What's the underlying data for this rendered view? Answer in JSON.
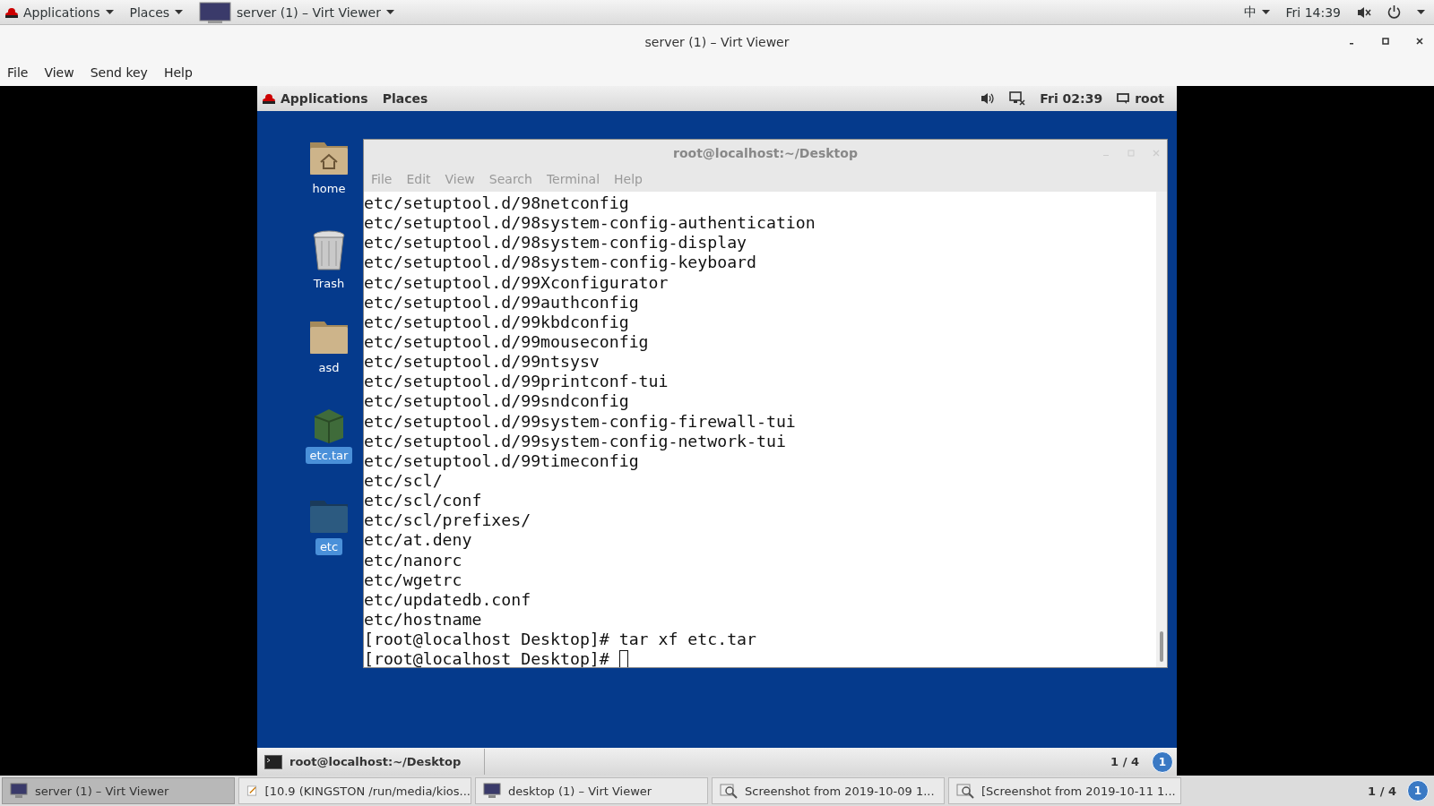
{
  "top_bar": {
    "applications": "Applications",
    "places": "Places",
    "active_app": "server (1) – Virt Viewer",
    "input_method": "中",
    "clock": "Fri 14:39"
  },
  "window": {
    "title": "server (1) – Virt Viewer"
  },
  "menu": [
    "File",
    "View",
    "Send key",
    "Help"
  ],
  "guest": {
    "top_bar": {
      "applications": "Applications",
      "places": "Places",
      "clock": "Fri 02:39",
      "user": "root"
    },
    "desktop_icons": [
      {
        "kind": "home",
        "label": "home",
        "selected": false
      },
      {
        "kind": "trash",
        "label": "Trash",
        "selected": false
      },
      {
        "kind": "folder",
        "label": "asd",
        "selected": false
      },
      {
        "kind": "archive",
        "label": "etc.tar",
        "selected": true
      },
      {
        "kind": "dark-folder",
        "label": "etc",
        "selected": true
      }
    ],
    "terminal": {
      "title": "root@localhost:~/Desktop",
      "menu": [
        "File",
        "Edit",
        "View",
        "Search",
        "Terminal",
        "Help"
      ],
      "lines": [
        "etc/setuptool.d/98netconfig",
        "etc/setuptool.d/98system-config-authentication",
        "etc/setuptool.d/98system-config-display",
        "etc/setuptool.d/98system-config-keyboard",
        "etc/setuptool.d/99Xconfigurator",
        "etc/setuptool.d/99authconfig",
        "etc/setuptool.d/99kbdconfig",
        "etc/setuptool.d/99mouseconfig",
        "etc/setuptool.d/99ntsysv",
        "etc/setuptool.d/99printconf-tui",
        "etc/setuptool.d/99sndconfig",
        "etc/setuptool.d/99system-config-firewall-tui",
        "etc/setuptool.d/99system-config-network-tui",
        "etc/setuptool.d/99timeconfig",
        "etc/scl/",
        "etc/scl/conf",
        "etc/scl/prefixes/",
        "etc/at.deny",
        "etc/nanorc",
        "etc/wgetrc",
        "etc/updatedb.conf",
        "etc/hostname",
        "[root@localhost Desktop]# tar xf etc.tar",
        "[root@localhost Desktop]# "
      ]
    },
    "bottom_panel": {
      "task": "root@localhost:~/Desktop",
      "workspace": "1 / 4",
      "badge": "1"
    }
  },
  "taskbar": [
    {
      "kind": "viewer",
      "label": "server (1) – Virt Viewer",
      "selected": true
    },
    {
      "kind": "editor",
      "label": "[10.9 (KINGSTON /run/media/kios...",
      "selected": false
    },
    {
      "kind": "viewer",
      "label": "desktop (1) – Virt Viewer",
      "selected": false
    },
    {
      "kind": "screenshot",
      "label": "Screenshot from 2019-10-09 1...",
      "selected": false
    },
    {
      "kind": "screenshot",
      "label": "[Screenshot from 2019-10-11 1...",
      "selected": false
    }
  ],
  "workspace": "1 / 4",
  "badge": "1"
}
